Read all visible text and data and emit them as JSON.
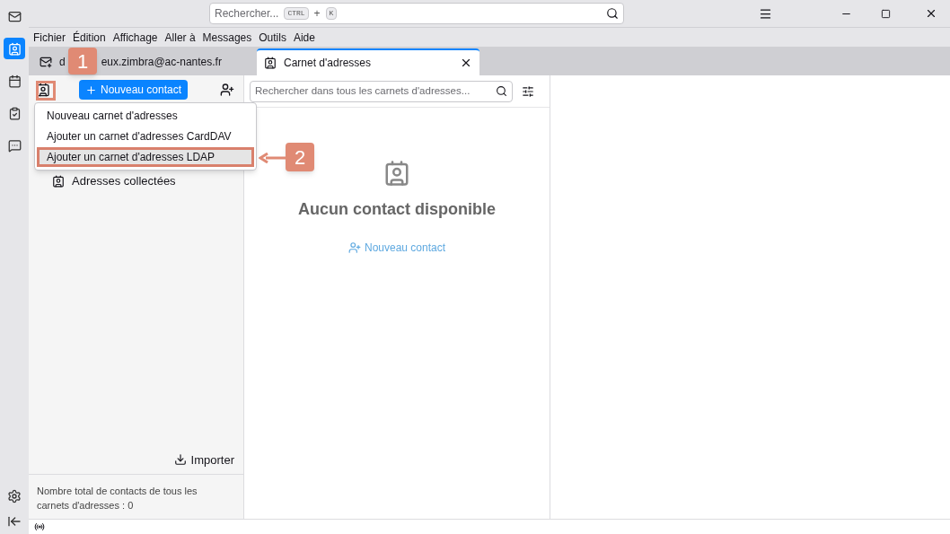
{
  "search": {
    "placeholder": "Rechercher...",
    "keys": [
      "CTRL",
      "+",
      "K"
    ]
  },
  "menu": [
    "Fichier",
    "Édition",
    "Affichage",
    "Aller à",
    "Messages",
    "Outils",
    "Aide"
  ],
  "spaces": [
    {
      "kind": "mail",
      "selected": false
    },
    {
      "kind": "contacts",
      "selected": true
    },
    {
      "kind": "calendar",
      "selected": false
    },
    {
      "kind": "tasks",
      "selected": false
    },
    {
      "kind": "chat",
      "selected": false
    }
  ],
  "tabs": [
    {
      "kind": "mail",
      "parts": [
        "d",
        "eux.zimbra@ac-nantes.fr"
      ],
      "selected": false
    },
    {
      "kind": "contacts",
      "parts": [
        "Carnet d'adresses"
      ],
      "selected": true
    }
  ],
  "new_contact_button": "Nouveau contact",
  "dropdown": [
    {
      "label": "Nouveau carnet d'adresses",
      "selected": false
    },
    {
      "label": "Ajouter un carnet d'adresses CardDAV",
      "selected": false
    },
    {
      "label": "Ajouter un carnet d'adresses LDAP",
      "selected": true
    }
  ],
  "books": [
    "Adresses collectées"
  ],
  "import_button": "Importer",
  "total": "Nombre total de contacts de tous les carnets d'adresses : 0",
  "list_search": {
    "placeholder": "Rechercher dans tous les carnets d'adresses..."
  },
  "empty": {
    "title": "Aucun contact disponible",
    "link": "Nouveau contact"
  },
  "callouts": [
    "1",
    "2"
  ]
}
